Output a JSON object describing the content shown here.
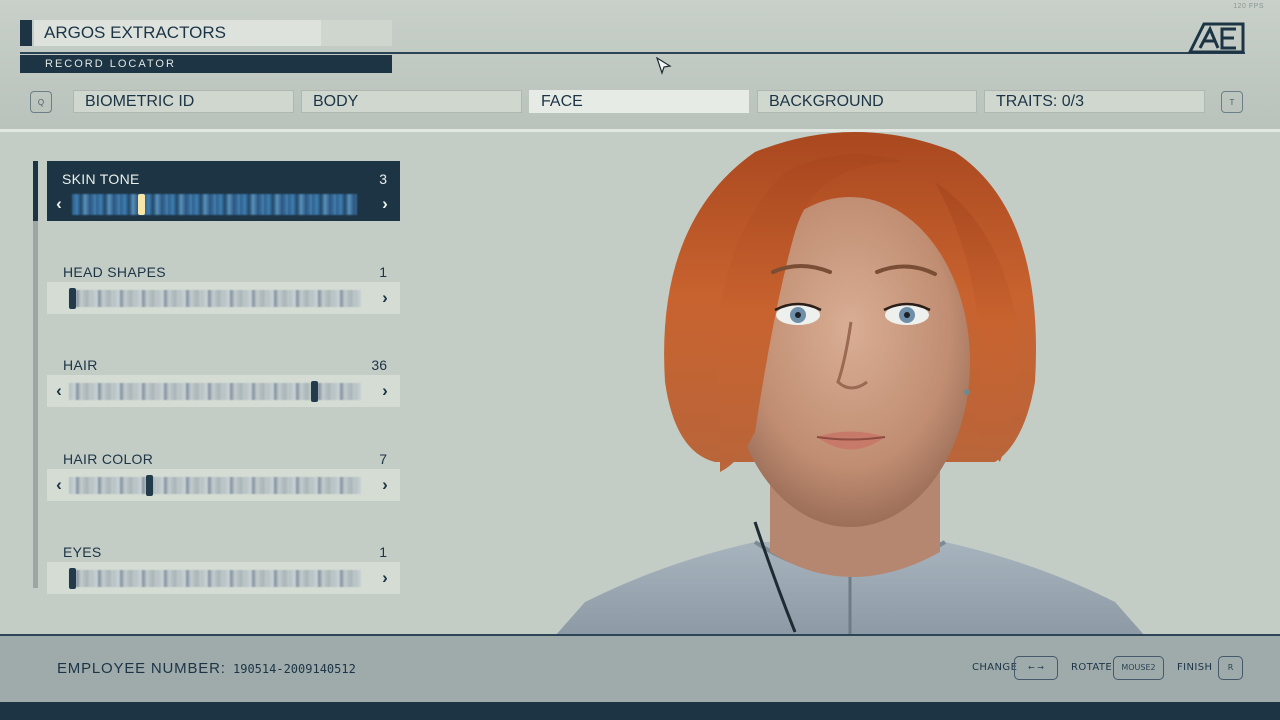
{
  "hud": {
    "fps": "120 FPS"
  },
  "header": {
    "title": "ARGOS EXTRACTORS",
    "subtitle": "RECORD LOCATOR",
    "prev_key": "Q",
    "next_key": "T",
    "logo_icon": "ae-logo"
  },
  "tabs": [
    {
      "label": "BIOMETRIC ID",
      "active": false
    },
    {
      "label": "BODY",
      "active": false
    },
    {
      "label": "FACE",
      "active": true
    },
    {
      "label": "BACKGROUND",
      "active": false
    },
    {
      "label": "TRAITS: 0/3",
      "active": false
    }
  ],
  "options": [
    {
      "label": "SKIN TONE",
      "value": "3",
      "selected": true,
      "level": 0.23
    },
    {
      "label": "HEAD SHAPES",
      "value": "1",
      "selected": false,
      "level": 0.0
    },
    {
      "label": "HAIR",
      "value": "36",
      "selected": false,
      "level": 0.85
    },
    {
      "label": "HAIR COLOR",
      "value": "7",
      "selected": false,
      "level": 0.27
    },
    {
      "label": "EYES",
      "value": "1",
      "selected": false,
      "level": 0.0
    }
  ],
  "footer": {
    "employee_label": "EMPLOYEE NUMBER:",
    "employee_number": "190514-2009140512",
    "change_label": "CHANGE",
    "change_key": "← →",
    "rotate_label": "ROTATE",
    "rotate_key": "MOUSE2",
    "finish_label": "FINISH",
    "finish_key": "R"
  },
  "colors": {
    "accent": "#1d3444",
    "panel": "#c3cdc5",
    "hair": "#b8542a"
  }
}
